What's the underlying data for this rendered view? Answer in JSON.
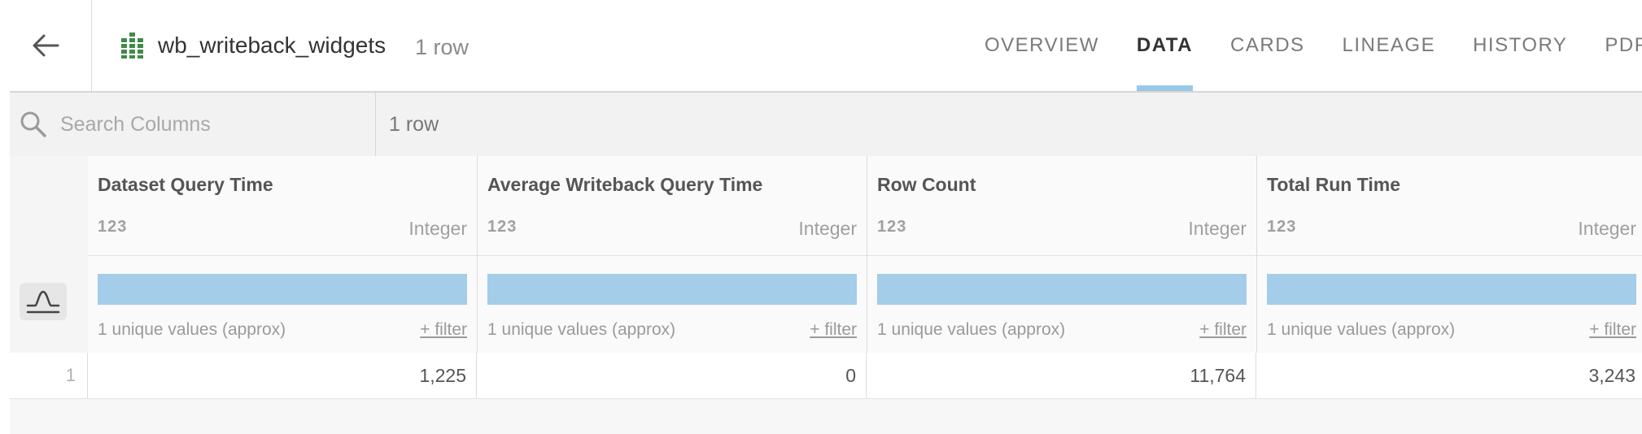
{
  "header": {
    "dataset_icon": "bar-chart-dataset-icon",
    "dataset_name": "wb_writeback_widgets",
    "row_count": "1 row",
    "tabs": [
      {
        "label": "OVERVIEW",
        "active": false
      },
      {
        "label": "DATA",
        "active": true
      },
      {
        "label": "CARDS",
        "active": false
      },
      {
        "label": "LINEAGE",
        "active": false
      },
      {
        "label": "HISTORY",
        "active": false
      },
      {
        "label": "PDP",
        "active": false
      }
    ]
  },
  "toolbar": {
    "search_placeholder": "Search Columns",
    "search_value": "",
    "row_count": "1 row"
  },
  "table": {
    "columns": [
      {
        "name": "Dataset Query Time",
        "type_icon": "123",
        "type": "Integer",
        "unique": "1 unique values (approx)",
        "filter": "+ filter"
      },
      {
        "name": "Average Writeback Query Time",
        "type_icon": "123",
        "type": "Integer",
        "unique": "1 unique values (approx)",
        "filter": "+ filter"
      },
      {
        "name": "Row Count",
        "type_icon": "123",
        "type": "Integer",
        "unique": "1 unique values (approx)",
        "filter": "+ filter"
      },
      {
        "name": "Total Run Time",
        "type_icon": "123",
        "type": "Integer",
        "unique": "1 unique values (approx)",
        "filter": "+ filter"
      }
    ],
    "rows": [
      {
        "num": "1",
        "cells": [
          "1,225",
          "0",
          "11,764",
          "3,243"
        ]
      }
    ]
  },
  "colors": {
    "accent": "#99c8e6",
    "distribution_bar": "#a3cde8",
    "toolbar_bg": "#f2f2f2",
    "dataset_icon": "#3f8a4a"
  }
}
